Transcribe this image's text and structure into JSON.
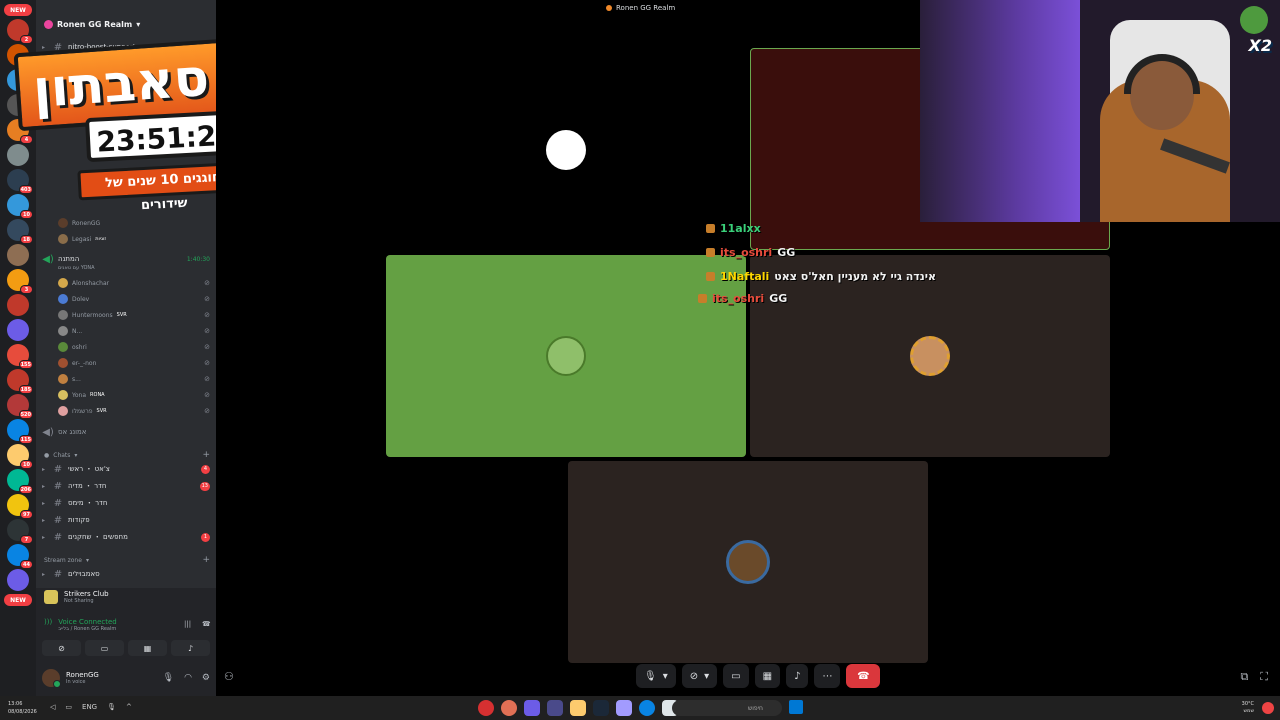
{
  "call": {
    "title": "Ronen GG Realm"
  },
  "server": {
    "name": "Ronen GG Realm",
    "pinned_channel": "nitro-boost-support"
  },
  "server_rail": [
    {
      "label": "NEW",
      "color": "#f23f43",
      "new": true
    },
    {
      "label": "",
      "color": "#c0392b",
      "badge": "2"
    },
    {
      "label": "",
      "color": "#d35400"
    },
    {
      "label": "",
      "color": "#3498db"
    },
    {
      "label": "",
      "color": "#555555"
    },
    {
      "label": "",
      "color": "#e67e22",
      "badge": "4"
    },
    {
      "label": "",
      "color": "#7f8c8d"
    },
    {
      "label": "",
      "color": "#2c3e50",
      "badge": "403"
    },
    {
      "label": "",
      "color": "#3498db",
      "badge": "10"
    },
    {
      "label": "",
      "color": "#34495e",
      "badge": "18"
    },
    {
      "label": "",
      "color": "#8e6e53"
    },
    {
      "label": "",
      "color": "#f39c12",
      "badge": "3"
    },
    {
      "label": "",
      "color": "#c0392b"
    },
    {
      "label": "",
      "color": "#6c5ce7"
    },
    {
      "label": "",
      "color": "#e74c3c",
      "badge": "155"
    },
    {
      "label": "",
      "color": "#c0392b",
      "badge": "185"
    },
    {
      "label": "",
      "color": "#b33939",
      "badge": "520"
    },
    {
      "label": "",
      "color": "#0984e3",
      "badge": "115"
    },
    {
      "label": "",
      "color": "#fdcb6e",
      "badge": "10"
    },
    {
      "label": "",
      "color": "#00b894",
      "badge": "206"
    },
    {
      "label": "",
      "color": "#f1c40f",
      "badge": "97"
    },
    {
      "label": "",
      "color": "#2d3436",
      "badge": "7"
    },
    {
      "label": "",
      "color": "#0984e3",
      "badge": "44"
    },
    {
      "label": "",
      "color": "#6c5ce7"
    },
    {
      "label": "NEW",
      "color": "#f23f43",
      "new": true
    }
  ],
  "overlay": {
    "title": "סאבתון",
    "timer": "23:51:29",
    "subtitle": "חוגגים 10 שנים של שידורים"
  },
  "voice_channel_1": {
    "members": [
      "RonenGG",
      "Legasi"
    ],
    "member_tags": [
      "",
      "זוגיות"
    ]
  },
  "voice_channel_2": {
    "name": "המתנה",
    "time": "1:40:30",
    "sub": "עם טאגים YONA",
    "members": [
      {
        "name": "Alonshachar",
        "tag": "",
        "color": "#d4a84b"
      },
      {
        "name": "Dolev",
        "tag": "",
        "color": "#4b7bd4"
      },
      {
        "name": "Huntermoons",
        "tag": "SVR",
        "color": "#777777"
      },
      {
        "name": "N...",
        "tag": "",
        "color": "#888888"
      },
      {
        "name": "oshri",
        "tag": "",
        "color": "#5a8a3a"
      },
      {
        "name": "er-_-non",
        "tag": "",
        "color": "#a05030"
      },
      {
        "name": "s...",
        "tag": "",
        "color": "#c08040"
      },
      {
        "name": "Yona",
        "tag": "RONA",
        "color": "#d8c060"
      },
      {
        "name": "פרשמלו",
        "tag": "SVR",
        "color": "#e0a0a0"
      }
    ]
  },
  "voice_channel_3": {
    "name": "אמונג אס"
  },
  "category_chats": "Chats",
  "text_channels": [
    {
      "name": "צ'אט ・ ראשי",
      "badge": "4"
    },
    {
      "name": "חדר ・ מדיה",
      "badge": "13"
    },
    {
      "name": "חדר ・ מימס",
      "badge": ""
    },
    {
      "name": "פקודות",
      "badge": ""
    },
    {
      "name": "מחפשים ・ שחקנים",
      "badge": "1"
    }
  ],
  "category_stream": "Stream zone",
  "stream_channel": "סאמבוילים",
  "rtc": {
    "activity_name": "Strikers Club",
    "activity_status": "Not Sharing",
    "voice_status": "Voice Connected",
    "voice_sub": "בלייב / Ronen GG Realm"
  },
  "user": {
    "name": "RonenGG",
    "status": "In voice"
  },
  "stream_chat": [
    {
      "user": "11alxx",
      "text": "",
      "color": "#3ad17a"
    },
    {
      "user": "its_oshri",
      "text": "GG",
      "color": "#e74c3c"
    },
    {
      "user": "1Naftali",
      "text": "אינדה גיי לא מעניין חאל'ס צאט",
      "color": "#ffd700"
    },
    {
      "user": "its_oshri",
      "text": "GG",
      "color": "#e74c3c"
    }
  ],
  "taskbar": {
    "time": "13:06",
    "date": "08/08/2026",
    "lang": "ENG",
    "search_placeholder": "חיפוש",
    "weather_temp": "30°C",
    "weather_desc": "שמש"
  },
  "colors": {
    "discord_bg": "#2b2d31",
    "rail_bg": "#1e1f22",
    "voice_green": "#23a55a",
    "end_call_red": "#da373c"
  }
}
